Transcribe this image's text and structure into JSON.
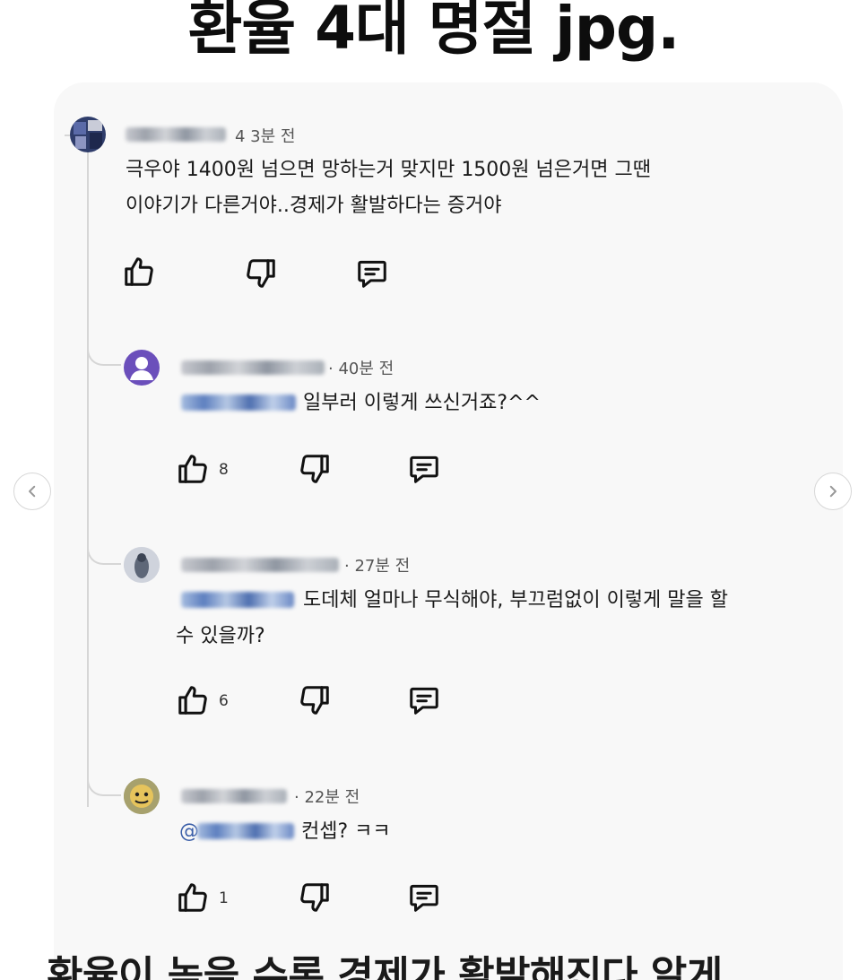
{
  "header": {
    "title": "환율 4대 명절 jpg."
  },
  "comments": [
    {
      "time": "4 3분 전",
      "lines": [
        "극우야 1400원 넘으면 망하는거 맞지만 1500원 넘은거면 그땐",
        "이야기가 다른거야..경제가 활발하다는 증거야"
      ]
    },
    {
      "time": "· 40분 전",
      "lines": [
        "일부러 이렇게 쓰신거죠?^^"
      ],
      "likes": "8"
    },
    {
      "time": "· 27분 전",
      "lines": [
        "도데체 얼마나 무식해야, 부끄럼없이 이렇게 말을 할",
        "수 있을까?"
      ],
      "likes": "6"
    },
    {
      "time": "· 22분 전",
      "mention_prefix": "@",
      "lines": [
        "컨셉? ㅋㅋ"
      ],
      "likes": "1"
    }
  ],
  "nav": {
    "prev_icon": "chevron-left-icon",
    "next_icon": "chevron-right-icon"
  },
  "footer": {
    "caption": "환율이 높을 수록 경제가 활발해진다 알게"
  },
  "colors": {
    "card_bg": "#f8f8f8",
    "thread_line": "#d6d6d6",
    "avatar_purple": "#6b4fbb"
  }
}
